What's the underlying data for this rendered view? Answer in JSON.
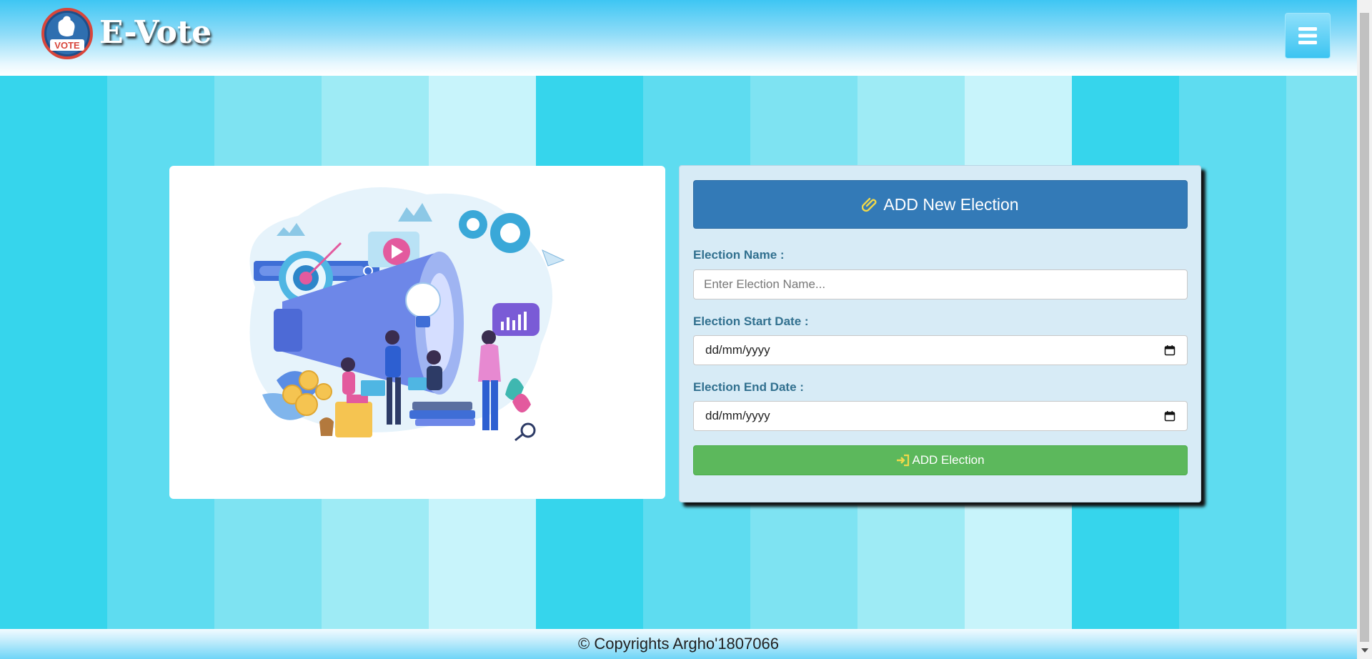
{
  "header": {
    "app_name": "E-Vote",
    "logo_badge": "VOTE",
    "menu_icon": "hamburger-icon"
  },
  "colors": {
    "stripes": [
      "#36d5ec",
      "#5edcf0",
      "#7ee3f2",
      "#9eebf5",
      "#c8f4fb",
      "#36d5ec",
      "#5edcf0",
      "#7ee3f2",
      "#9eebf5",
      "#c8f4fb",
      "#36d5ec",
      "#5edcf0",
      "#7ee3f2"
    ],
    "primary": "#337ab7",
    "success": "#5cb85c",
    "label": "#31708f"
  },
  "form": {
    "title": "ADD New Election",
    "title_icon": "paperclip-icon",
    "name_label": "Election Name :",
    "name_placeholder": "Enter Election Name...",
    "start_label": "Election Start Date :",
    "start_value": "dd/mm/yyyy",
    "end_label": "Election End Date :",
    "end_value": "dd/mm/yyyy",
    "submit_label": "ADD Election",
    "submit_icon": "log-in-icon"
  },
  "footer": {
    "copyright": "© Copyrights Argho'1807066"
  }
}
